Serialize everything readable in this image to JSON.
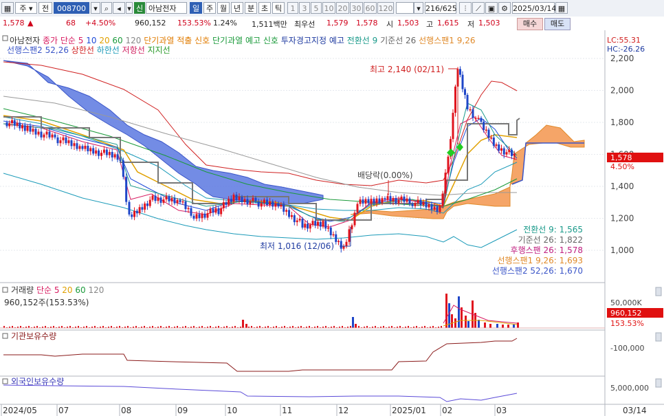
{
  "toolbar": {
    "period": "주",
    "market": "전",
    "code": "008700",
    "stock_name": "아남전자",
    "credit_badge": "신",
    "timeframes": [
      "일",
      "주",
      "월",
      "년",
      "분",
      "초",
      "틱"
    ],
    "intervals": [
      "1",
      "3",
      "5",
      "10",
      "20",
      "30",
      "60",
      "120"
    ],
    "count": "216/625",
    "date": "2025/03/14"
  },
  "quote": {
    "price": "1,578",
    "change": "68",
    "change_pct": "+4.50%",
    "volume": "960,152",
    "volume_ratio": "153.53%",
    "turnover_ratio": "1.24%",
    "amount": "1,511백만",
    "best_label": "최우선",
    "best_ask": "1,579",
    "best_bid": "1,578",
    "open_label": "시",
    "open": "1,503",
    "high_label": "고",
    "high": "1,615",
    "low_label": "저",
    "low": "1,503",
    "buy": "매수",
    "sell": "매도"
  },
  "legend": {
    "row1": [
      {
        "text": "아남전자",
        "color": "#333333"
      },
      {
        "text": "종가 단순 5",
        "color": "#d81b60"
      },
      {
        "text": "10",
        "color": "#1e4bd8"
      },
      {
        "text": "20",
        "color": "#e0a000"
      },
      {
        "text": "60",
        "color": "#1a9a3a"
      },
      {
        "text": "120",
        "color": "#888888"
      },
      {
        "text": "단기과열 적출 신호",
        "color": "#e07b00"
      },
      {
        "text": "단기과열 예고 신호",
        "color": "#1a9a3a"
      },
      {
        "text": "투자경고지정 예고",
        "color": "#1e3aa0"
      },
      {
        "text": "전환선 9",
        "color": "#1a9a8a"
      },
      {
        "text": "기준선 26",
        "color": "#666666"
      },
      {
        "text": "선행스팬1 9,26",
        "color": "#e08a2a"
      }
    ],
    "row2": [
      {
        "text": "선행스팬2 52,26",
        "color": "#3a55c8"
      },
      {
        "text": "상한선",
        "color": "#d02020"
      },
      {
        "text": "하한선",
        "color": "#1a9ab8"
      },
      {
        "text": "저항선",
        "color": "#d02060"
      },
      {
        "text": "지지선",
        "color": "#2a9a2a"
      }
    ],
    "lc": "LC:55.31",
    "hc": "HC:-26.26"
  },
  "annotations": {
    "high": "최고 2,140 (02/11)",
    "low": "최저 1,016 (12/06)",
    "dividend": "배당락(0.00%)",
    "current_price": "1,578",
    "current_pct": "4.50%"
  },
  "ichimoku_values": [
    {
      "text": "전환선 9: 1,565",
      "color": "#1a9a8a"
    },
    {
      "text": "기준선 26: 1,822",
      "color": "#666666"
    },
    {
      "text": "후행스팬 26: 1,578",
      "color": "#c02080"
    },
    {
      "text": "선행스팬1 9,26: 1,693",
      "color": "#e08a2a"
    },
    {
      "text": "선행스팬2 52,26: 1,670",
      "color": "#3a55c8"
    }
  ],
  "volume_panel": {
    "legend": [
      {
        "text": "거래량",
        "color": "#333333"
      },
      {
        "text": "단순 5",
        "color": "#d81b60"
      },
      {
        "text": "20",
        "color": "#e0a000"
      },
      {
        "text": "60",
        "color": "#1a9a3a"
      },
      {
        "text": "120",
        "color": "#888888"
      }
    ],
    "summary": "960,152주(153.53%)",
    "axis_label": "50,000K",
    "current": "960,152",
    "current_pct": "153.53%"
  },
  "inst_panel": {
    "title": "기관보유수량",
    "axis_label": "-100,000"
  },
  "foreign_panel": {
    "title": "외국인보유수량",
    "axis_label": "5,000,000"
  },
  "x_axis": {
    "labels": [
      "2024/05",
      "07",
      "08",
      "09",
      "10",
      "11",
      "12",
      "2025/01",
      "02",
      "03"
    ],
    "right_label": "03/14"
  },
  "chart_data": {
    "type": "candlestick",
    "y_ticks": [
      1000,
      1200,
      1400,
      1600,
      1800,
      2000,
      2200
    ],
    "ylim": [
      900,
      2270
    ],
    "price_series": [
      {
        "date": "2024/06/10",
        "close": 1800
      },
      {
        "date": "2024/06/24",
        "close": 1760
      },
      {
        "date": "2024/07/08",
        "close": 1700
      },
      {
        "date": "2024/07/22",
        "close": 1640
      },
      {
        "date": "2024/08/01",
        "close": 1580
      },
      {
        "date": "2024/08/05",
        "close": 1200
      },
      {
        "date": "2024/08/19",
        "close": 1330
      },
      {
        "date": "2024/09/02",
        "close": 1300
      },
      {
        "date": "2024/09/23",
        "close": 1210
      },
      {
        "date": "2024/10/07",
        "close": 1250
      },
      {
        "date": "2024/10/14",
        "close": 1330
      },
      {
        "date": "2024/10/28",
        "close": 1300
      },
      {
        "date": "2024/11/11",
        "close": 1280
      },
      {
        "date": "2024/11/18",
        "close": 1160
      },
      {
        "date": "2024/12/02",
        "close": 1160
      },
      {
        "date": "2024/12/06",
        "close": 1016
      },
      {
        "date": "2024/12/16",
        "close": 1290
      },
      {
        "date": "2025/01/06",
        "close": 1330
      },
      {
        "date": "2025/01/20",
        "close": 1300
      },
      {
        "date": "2025/02/03",
        "close": 1260
      },
      {
        "date": "2025/02/06",
        "close": 1580
      },
      {
        "date": "2025/02/11",
        "close": 2140
      },
      {
        "date": "2025/02/18",
        "close": 1900
      },
      {
        "date": "2025/02/25",
        "close": 1780
      },
      {
        "date": "2025/03/05",
        "close": 1650
      },
      {
        "date": "2025/03/14",
        "close": 1578
      }
    ]
  }
}
